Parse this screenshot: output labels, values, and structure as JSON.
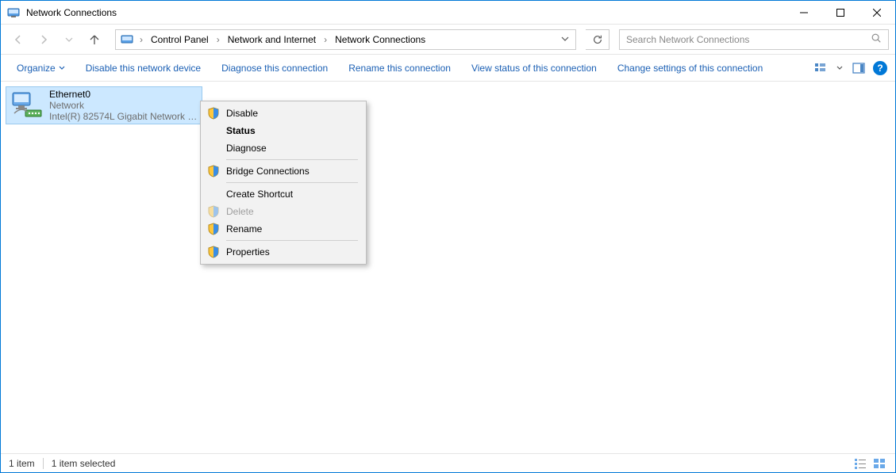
{
  "window": {
    "title": "Network Connections"
  },
  "breadcrumb": {
    "items": [
      "Control Panel",
      "Network and Internet",
      "Network Connections"
    ]
  },
  "search": {
    "placeholder": "Search Network Connections"
  },
  "commands": {
    "organize": "Organize",
    "disable_device": "Disable this network device",
    "diagnose": "Diagnose this connection",
    "rename": "Rename this connection",
    "view_status": "View status of this connection",
    "change_settings": "Change settings of this connection"
  },
  "connection": {
    "name": "Ethernet0",
    "network": "Network",
    "device": "Intel(R) 82574L Gigabit Network C..."
  },
  "context_menu": {
    "disable": "Disable",
    "status": "Status",
    "diagnose": "Diagnose",
    "bridge": "Bridge Connections",
    "create_shortcut": "Create Shortcut",
    "delete": "Delete",
    "rename": "Rename",
    "properties": "Properties"
  },
  "statusbar": {
    "count": "1 item",
    "selected": "1 item selected"
  }
}
